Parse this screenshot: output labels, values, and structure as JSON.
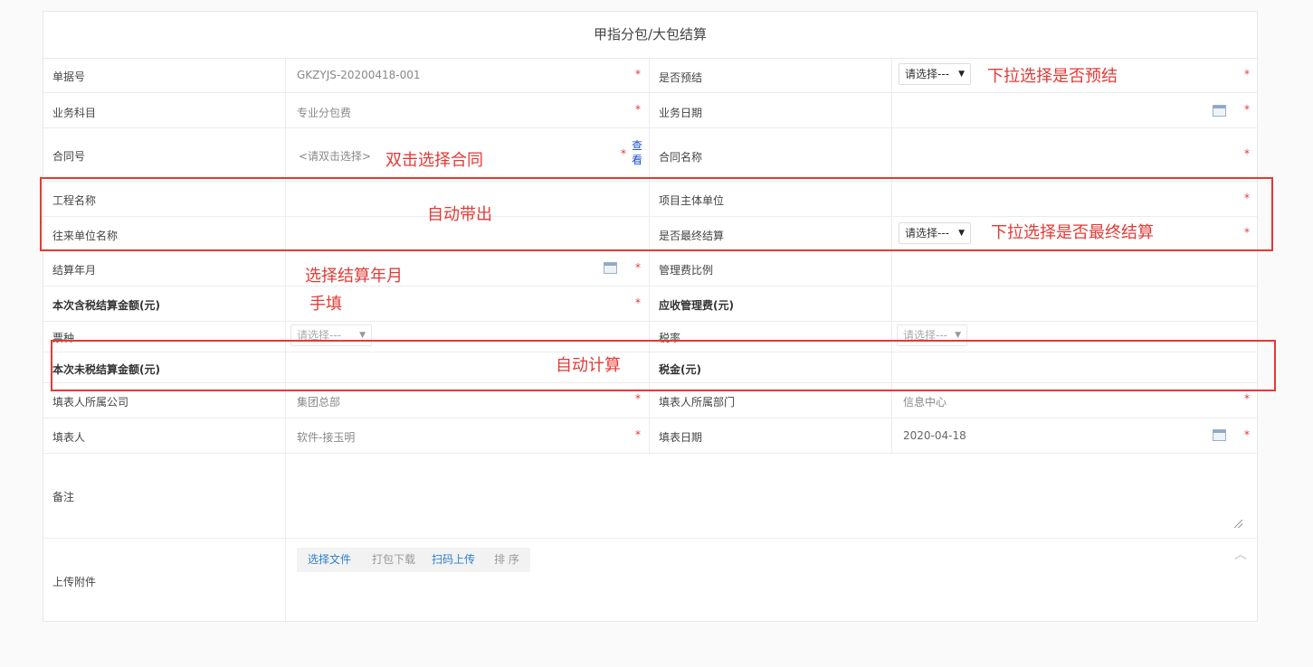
{
  "form": {
    "title": "甲指分包/大包结算",
    "fields": {
      "bill_no_label": "单据号",
      "bill_no_value": "GKZYJS-20200418-001",
      "is_pre_label": "是否预结",
      "is_pre_select": "请选择---",
      "biz_subject_label": "业务科目",
      "biz_subject_value": "专业分包费",
      "biz_date_label": "业务日期",
      "contract_no_label": "合同号",
      "contract_no_placeholder": "<请双击选择>",
      "view_link": "查看",
      "contract_name_label": "合同名称",
      "project_name_label": "工程名称",
      "project_unit_label": "项目主体单位",
      "partner_unit_label": "往来单位名称",
      "is_final_label": "是否最终结算",
      "is_final_select": "请选择---",
      "settle_month_label": "结算年月",
      "mgmt_ratio_label": "管理费比例",
      "amount_tax_label": "本次含税结算金额(元)",
      "mgmt_fee_label": "应收管理费(元)",
      "ticket_type_label": "票种",
      "ticket_type_select": "请选择---",
      "tax_rate_label": "税率",
      "tax_rate_select": "请选择---",
      "amount_notax_label": "本次未税结算金额(元)",
      "tax_label": "税金(元)",
      "company_label": "填表人所属公司",
      "company_value": "集团总部",
      "dept_label": "填表人所属部门",
      "dept_value": "信息中心",
      "filler_label": "填表人",
      "filler_value": "软件-接玉明",
      "fill_date_label": "填表日期",
      "fill_date_value": "2020-04-18",
      "remark_label": "备注",
      "upload_label": "上传附件"
    },
    "required_mark": "*",
    "upload_buttons": {
      "select_file": "选择文件",
      "pack_download": "打包下载",
      "scan_upload": "扫码上传",
      "sort": "排 序"
    }
  },
  "annotations": {
    "pre_select": "下拉选择是否预结",
    "double_click": "双击选择合同",
    "auto_fill": "自动带出",
    "final_select": "下拉选择是否最终结算",
    "choose_month": "选择结算年月",
    "manual": "手填",
    "auto_calc": "自动计算"
  }
}
